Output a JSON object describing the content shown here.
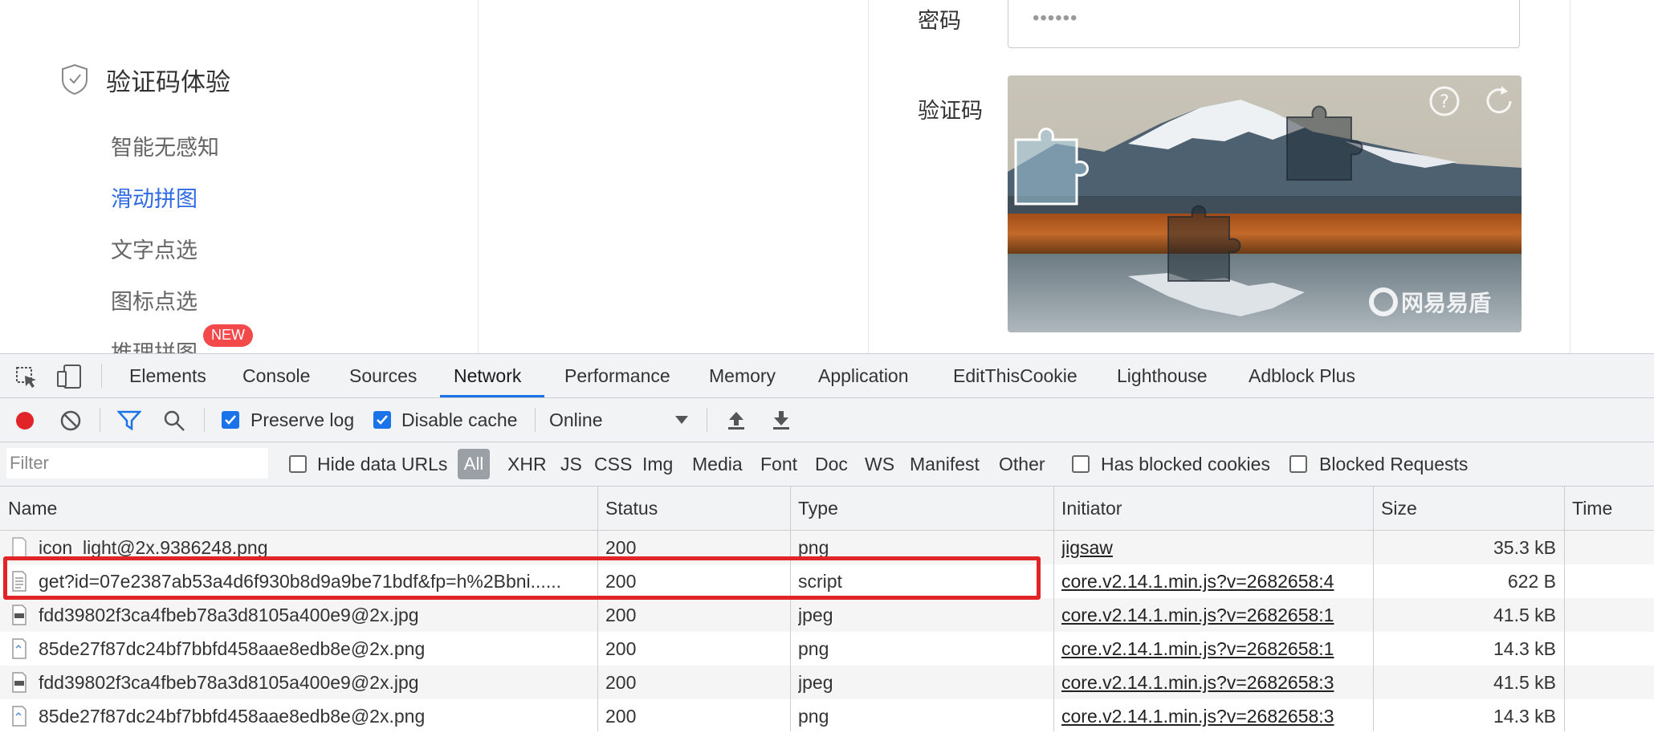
{
  "sidebar": {
    "title": "验证码体验",
    "items": [
      {
        "label": "智能无感知",
        "active": false
      },
      {
        "label": "滑动拼图",
        "active": true
      },
      {
        "label": "文字点选",
        "active": false
      },
      {
        "label": "图标点选",
        "active": false
      },
      {
        "label": "推理拼图",
        "active": false,
        "badge": "NEW"
      }
    ]
  },
  "form": {
    "password_label": "密码",
    "password_value": "••••••",
    "captcha_label": "验证码",
    "captcha_watermark": "网易易盾",
    "help_icon": "question-circle-icon",
    "refresh_icon": "refresh-icon"
  },
  "devtools": {
    "tabs": [
      "Elements",
      "Console",
      "Sources",
      "Network",
      "Performance",
      "Memory",
      "Application",
      "EditThisCookie",
      "Lighthouse",
      "Adblock Plus"
    ],
    "active_tab": "Network",
    "toolbar": {
      "preserve_log": "Preserve log",
      "preserve_log_checked": true,
      "disable_cache": "Disable cache",
      "disable_cache_checked": true,
      "throttling": "Online"
    },
    "filter": {
      "placeholder": "Filter",
      "hide_data_urls": "Hide data URLs",
      "types": [
        "All",
        "XHR",
        "JS",
        "CSS",
        "Img",
        "Media",
        "Font",
        "Doc",
        "WS",
        "Manifest",
        "Other"
      ],
      "active_type": "All",
      "has_blocked_cookies": "Has blocked cookies",
      "blocked_requests": "Blocked Requests"
    },
    "columns": [
      "Name",
      "Status",
      "Type",
      "Initiator",
      "Size",
      "Time"
    ],
    "rows": [
      {
        "name": "icon_light@2x.9386248.png",
        "status": "200",
        "type": "png",
        "initiator": "jigsaw",
        "size": "35.3 kB",
        "icon": "image-file-icon"
      },
      {
        "name": "get?id=07e2387ab53a4d6f930b8d9a9be71bdf&fp=h%2Bbni......",
        "status": "200",
        "type": "script",
        "initiator": "core.v2.14.1.min.js?v=2682658:4",
        "size": "622 B",
        "icon": "script-file-icon",
        "highlighted": true
      },
      {
        "name": "fdd39802f3ca4fbeb78a3d8105a400e9@2x.jpg",
        "status": "200",
        "type": "jpeg",
        "initiator": "core.v2.14.1.min.js?v=2682658:1",
        "size": "41.5 kB",
        "icon": "jpeg-file-icon"
      },
      {
        "name": "85de27f87dc24bf7bbfd458aae8edb8e@2x.png",
        "status": "200",
        "type": "png",
        "initiator": "core.v2.14.1.min.js?v=2682658:1",
        "size": "14.3 kB",
        "icon": "png-file-icon"
      },
      {
        "name": "fdd39802f3ca4fbeb78a3d8105a400e9@2x.jpg",
        "status": "200",
        "type": "jpeg",
        "initiator": "core.v2.14.1.min.js?v=2682658:3",
        "size": "41.5 kB",
        "icon": "jpeg-file-icon"
      },
      {
        "name": "85de27f87dc24bf7bbfd458aae8edb8e@2x.png",
        "status": "200",
        "type": "png",
        "initiator": "core.v2.14.1.min.js?v=2682658:3",
        "size": "14.3 kB",
        "icon": "png-file-icon"
      }
    ],
    "colors": {
      "record": "#e02427",
      "accent": "#1a73e8",
      "highlight": "#e02427"
    }
  }
}
